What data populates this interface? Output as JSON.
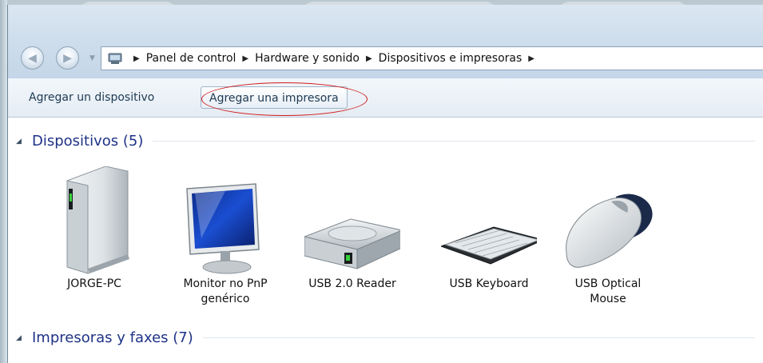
{
  "breadcrumb": {
    "items": [
      "Panel de control",
      "Hardware y sonido",
      "Dispositivos e impresoras"
    ]
  },
  "toolbar": {
    "add_device": "Agregar un dispositivo",
    "add_printer": "Agregar una impresora"
  },
  "groups": {
    "devices": {
      "title": "Dispositivos (5)"
    },
    "printers": {
      "title": "Impresoras y faxes (7)"
    }
  },
  "devices": [
    {
      "label": "JORGE-PC",
      "icon": "computer-tower-icon"
    },
    {
      "label": "Monitor no PnP genérico",
      "icon": "monitor-icon"
    },
    {
      "label": "USB 2.0 Reader",
      "icon": "disk-drive-icon"
    },
    {
      "label": "USB Keyboard",
      "icon": "keyboard-icon"
    },
    {
      "label": "USB Optical Mouse",
      "icon": "mouse-icon"
    }
  ],
  "colors": {
    "group_title": "#1e3287",
    "highlight_ellipse": "#d01a1a",
    "toolbar_text": "#1e3a52"
  }
}
